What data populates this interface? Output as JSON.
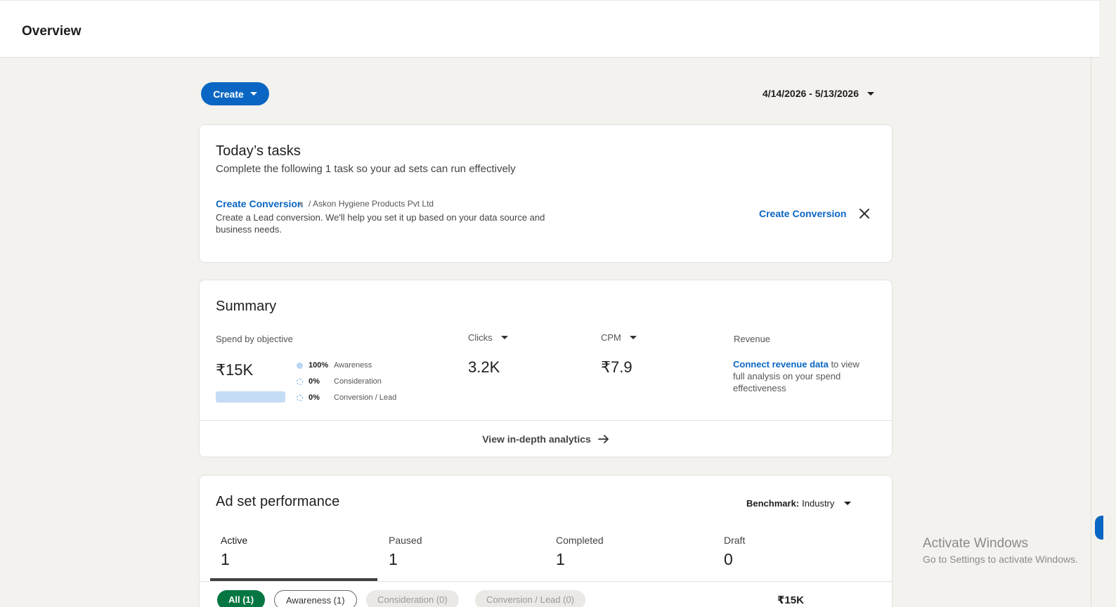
{
  "header": {
    "title": "Overview"
  },
  "toolbar": {
    "create_label": "Create",
    "date_range": "4/14/2026 - 5/13/2026"
  },
  "tasks": {
    "title": "Today’s tasks",
    "subtitle": "Complete the following 1 task so your ad sets can run effectively",
    "item": {
      "link": "Create Conversion",
      "account": "/ Askon Hygiene Products Pvt Ltd",
      "description": "Create a Lead conversion. We'll help you set it up based on your data source and business needs.",
      "action": "Create Conversion"
    }
  },
  "summary": {
    "title": "Summary",
    "spend_label": "Spend by objective",
    "spend_value": "₹15K",
    "objectives": [
      {
        "pct": "100%",
        "name": "Awareness"
      },
      {
        "pct": "0%",
        "name": "Consideration"
      },
      {
        "pct": "0%",
        "name": "Conversion / Lead"
      }
    ],
    "clicks_label": "Clicks",
    "clicks_value": "3.2K",
    "cpm_label": "CPM",
    "cpm_value": "₹7.9",
    "revenue_label": "Revenue",
    "revenue_link": "Connect revenue data",
    "revenue_text": " to view full analysis on your spend effectiveness",
    "footer_link": "View in-depth analytics"
  },
  "adset": {
    "title": "Ad set performance",
    "benchmark_label": "Benchmark:",
    "benchmark_value": "Industry",
    "tabs": [
      {
        "label": "Active",
        "count": "1"
      },
      {
        "label": "Paused",
        "count": "1"
      },
      {
        "label": "Completed",
        "count": "1"
      },
      {
        "label": "Draft",
        "count": "0"
      }
    ],
    "pills": [
      "All (1)",
      "Awareness (1)",
      "Consideration (0)",
      "Conversion / Lead (0)"
    ],
    "pill_right": "₹15K"
  },
  "watermark": {
    "line1": "Activate Windows",
    "line2": "Go to Settings to activate Windows."
  }
}
